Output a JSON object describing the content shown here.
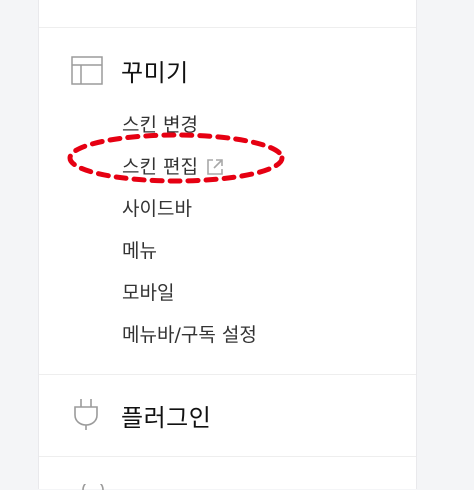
{
  "sections": {
    "decorate": {
      "icon": "layout-icon",
      "title": "꾸미기",
      "items": [
        {
          "label": "스킨 변경"
        },
        {
          "label": "스킨 편집",
          "external_icon": "external-link-icon"
        },
        {
          "label": "사이드바"
        },
        {
          "label": "메뉴"
        },
        {
          "label": "모바일"
        },
        {
          "label": "메뉴바/구독 설정"
        }
      ]
    },
    "plugin": {
      "icon": "plug-icon",
      "title": "플러그인"
    }
  },
  "colors": {
    "highlight": "#e60012",
    "icon": "#9b9b9b",
    "background": "#f4f5f7",
    "panel": "#ffffff"
  }
}
